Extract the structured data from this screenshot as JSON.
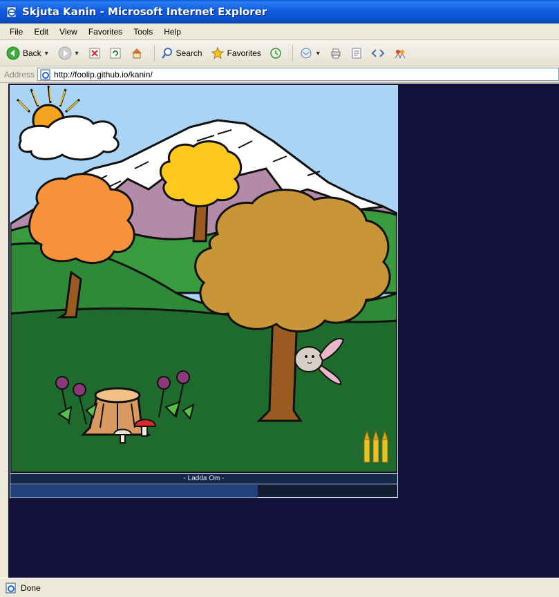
{
  "window": {
    "title": "Skjuta Kanin - Microsoft Internet Explorer"
  },
  "menu": {
    "items": [
      "File",
      "Edit",
      "View",
      "Favorites",
      "Tools",
      "Help"
    ]
  },
  "toolbar": {
    "back_label": "Back",
    "search_label": "Search",
    "favorites_label": "Favorites"
  },
  "address": {
    "label": "Address",
    "url": "http://foolip.github.io/kanin/"
  },
  "game": {
    "reload_label": "- Ladda Om -",
    "reload_progress": 0.64,
    "bullets_remaining": 3,
    "colors": {
      "sky": "#a9d4f5",
      "grass": "#1f6b2e",
      "page_bg": "#14113a",
      "progress": "#22407c"
    }
  },
  "status": {
    "text": "Done"
  }
}
